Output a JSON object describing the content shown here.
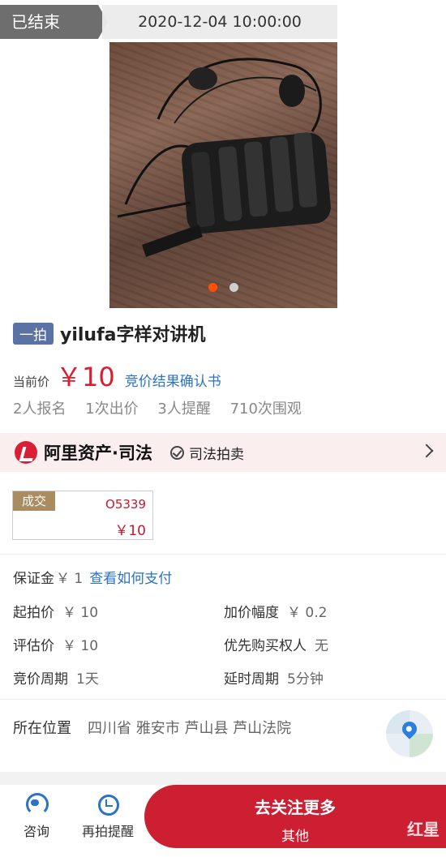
{
  "header": {
    "status": "已结束",
    "datetime": "2020-12-04 10:00:00"
  },
  "gallery": {
    "image_count": 2,
    "active_index": 0
  },
  "product": {
    "badge": "一拍",
    "title": "yilufa字样对讲机",
    "price_label": "当前价",
    "price": "￥10",
    "confirm_link": "竞价结果确认书",
    "stats": [
      "2人报名",
      "1次出价",
      "3人提醒",
      "710次围观"
    ]
  },
  "banner": {
    "title": "阿里资产·司法",
    "tag": "司法拍卖"
  },
  "deal": {
    "label": "成交",
    "code": "O5339",
    "price": "￥10"
  },
  "info": {
    "deposit_label": "保证金",
    "deposit_value": "￥ 1",
    "deposit_link": "查看如何支付",
    "items": [
      {
        "label": "起拍价",
        "value": "￥ 10"
      },
      {
        "label": "加价幅度",
        "value": "￥ 0.2"
      },
      {
        "label": "评估价",
        "value": "￥ 10"
      },
      {
        "label": "优先购买权人",
        "value": "无"
      },
      {
        "label": "竞价周期",
        "value": "1天"
      },
      {
        "label": "延时周期",
        "value": "5分钟"
      }
    ],
    "location_label": "所在位置",
    "location_value": "四川省 雅安市 芦山县 芦山法院"
  },
  "bottom": {
    "consult": "咨询",
    "remind": "再拍提醒",
    "follow_main": "去关注更多",
    "follow_sub": "其他",
    "watermark": "红星"
  },
  "colors": {
    "accent": "#d81e32",
    "link": "#2a73c5",
    "badge": "#5a72a6",
    "deal_tag": "#a98c5f"
  }
}
